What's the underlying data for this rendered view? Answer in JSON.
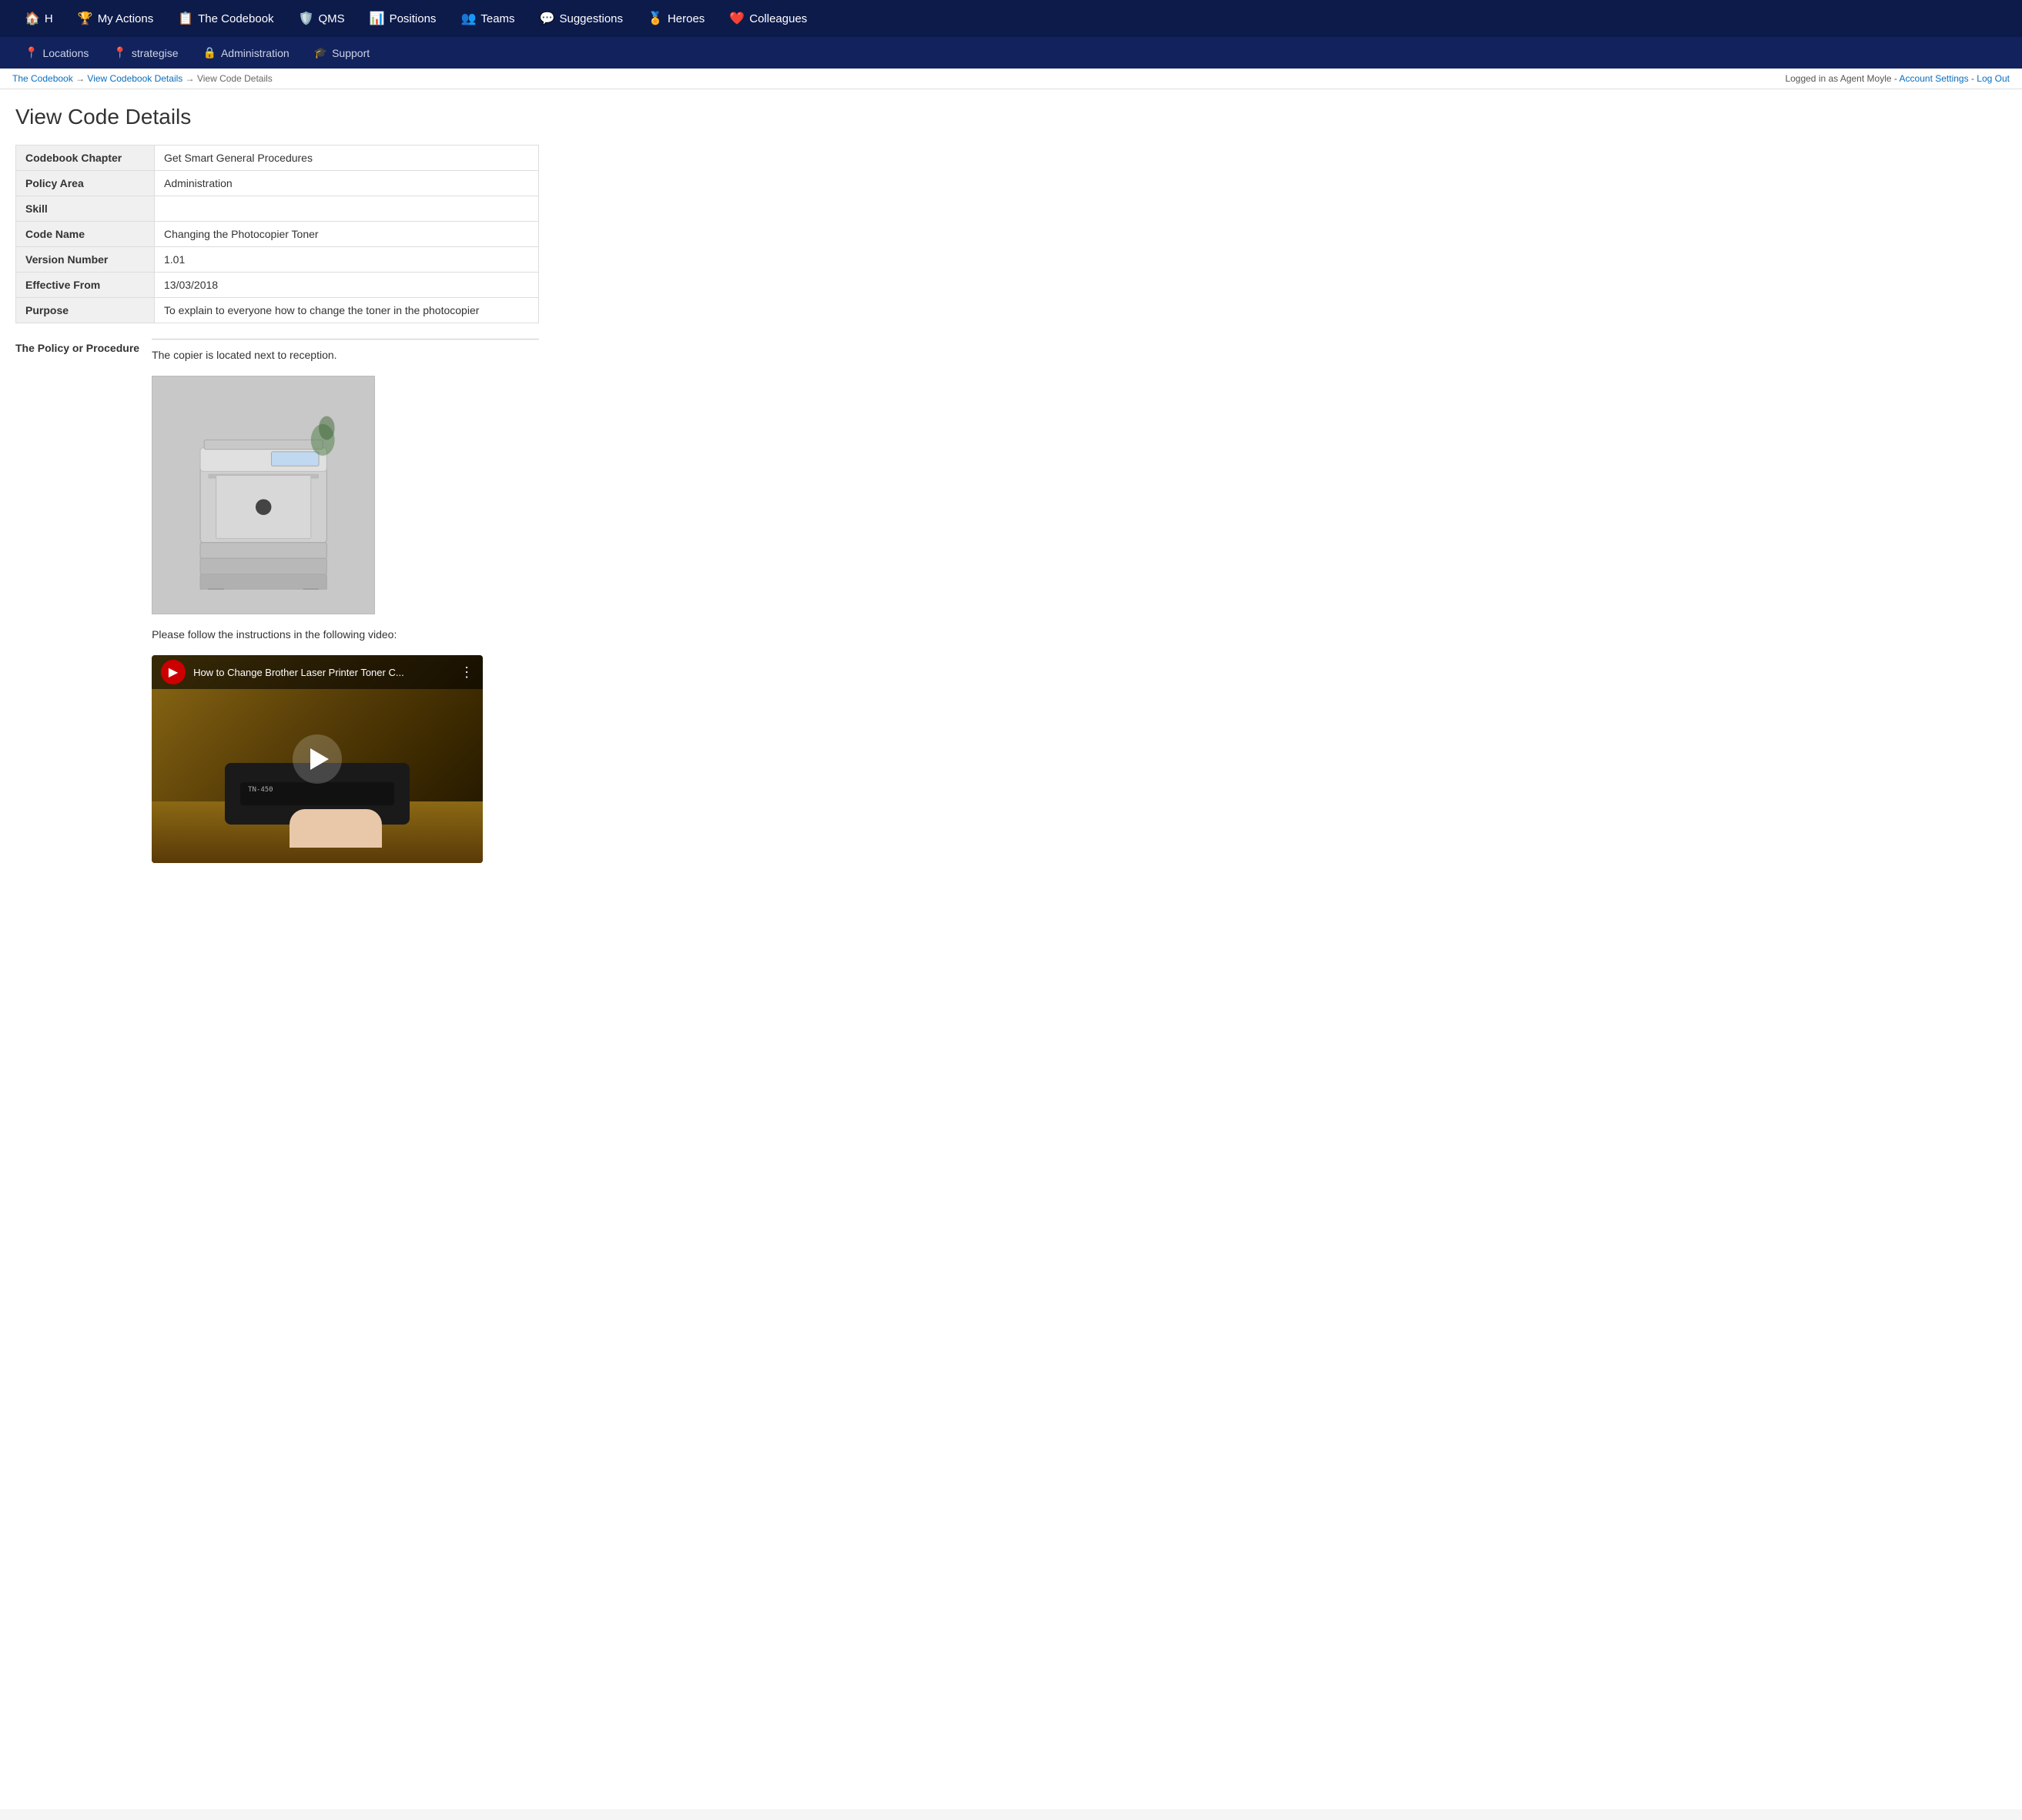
{
  "nav": {
    "top_items": [
      {
        "label": "H",
        "icon": "🏠",
        "href": "#"
      },
      {
        "label": "My Actions",
        "icon": "🏆",
        "href": "#"
      },
      {
        "label": "The Codebook",
        "icon": "📋",
        "href": "#"
      },
      {
        "label": "QMS",
        "icon": "🛡️",
        "href": "#"
      },
      {
        "label": "Positions",
        "icon": "📊",
        "href": "#"
      },
      {
        "label": "Teams",
        "icon": "👥",
        "href": "#"
      },
      {
        "label": "Suggestions",
        "icon": "💬",
        "href": "#"
      },
      {
        "label": "Heroes",
        "icon": "🏅",
        "href": "#"
      },
      {
        "label": "Colleagues",
        "icon": "❤️",
        "href": "#"
      }
    ],
    "sub_items": [
      {
        "label": "Locations",
        "icon": "📍",
        "href": "#"
      },
      {
        "label": "strategise",
        "icon": "📍",
        "href": "#"
      },
      {
        "label": "Administration",
        "icon": "🔒",
        "href": "#"
      },
      {
        "label": "Support",
        "icon": "🎓",
        "href": "#"
      }
    ]
  },
  "breadcrumb": {
    "items": [
      {
        "label": "The Codebook",
        "href": "#"
      },
      {
        "label": "View Codebook Details",
        "href": "#"
      },
      {
        "label": "View Code Details",
        "href": null
      }
    ]
  },
  "account": {
    "logged_in_text": "Logged in as Agent Moyle - ",
    "settings_label": "Account Settings",
    "separator": " - ",
    "logout_label": "Log Out"
  },
  "page": {
    "title": "View Code Details"
  },
  "details": [
    {
      "label": "Codebook Chapter",
      "value": "Get Smart General Procedures"
    },
    {
      "label": "Policy Area",
      "value": "Administration"
    },
    {
      "label": "Skill",
      "value": ""
    },
    {
      "label": "Code Name",
      "value": "Changing the Photocopier Toner"
    },
    {
      "label": "Version Number",
      "value": "1.01"
    },
    {
      "label": "Effective From",
      "value": "13/03/2018"
    },
    {
      "label": "Purpose",
      "value": "To explain to everyone how to change the toner in the photocopier"
    }
  ],
  "policy": {
    "section_label": "The Policy or Procedure",
    "intro_text": "The copier is located next to reception.",
    "video_intro_text": "Please follow the instructions in the following video:",
    "video_title": "How to Change Brother Laser Printer Toner C..."
  }
}
